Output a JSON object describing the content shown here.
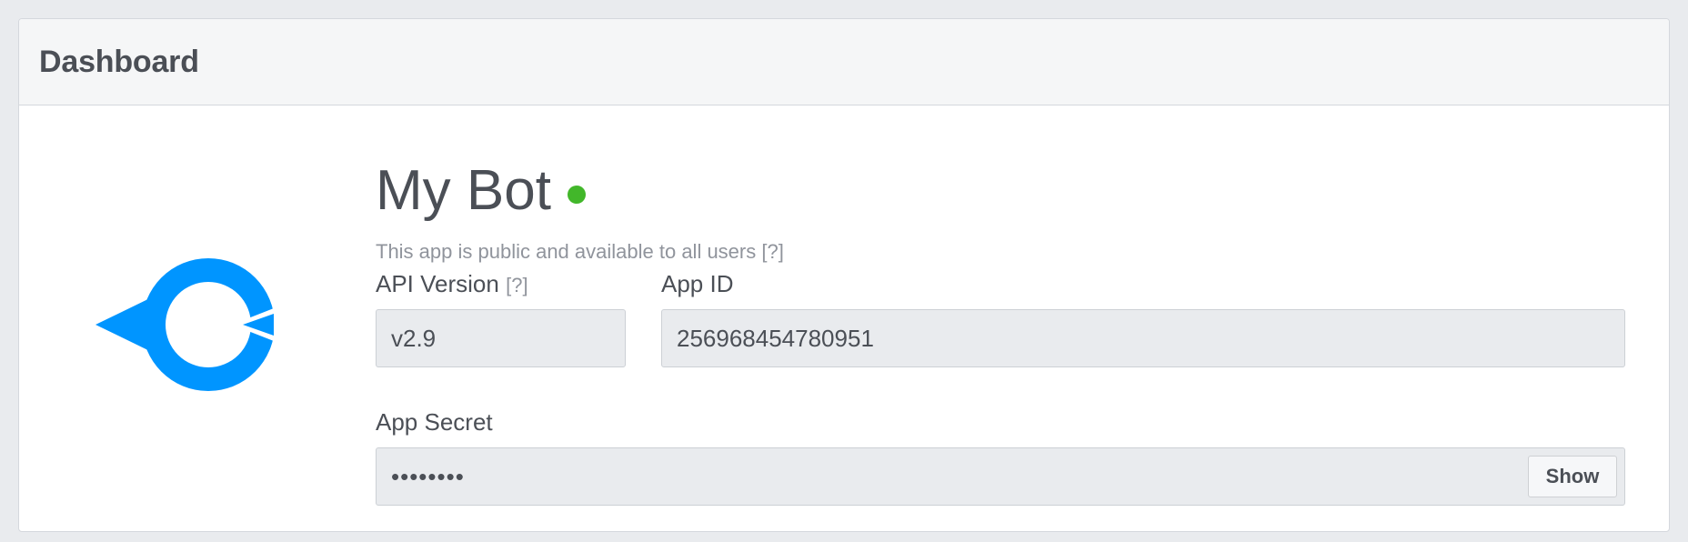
{
  "panel": {
    "title": "Dashboard"
  },
  "app": {
    "icon": "messenger-bot-icon",
    "icon_color": "#0095ff",
    "name": "My Bot",
    "status_color": "#42b72a",
    "description": "This app is public and available to all users [?]"
  },
  "fields": {
    "api_version": {
      "label": "API Version",
      "help": "[?]",
      "value": "v2.9"
    },
    "app_id": {
      "label": "App ID",
      "value": "256968454780951"
    },
    "app_secret": {
      "label": "App Secret",
      "value": "••••••••",
      "show_label": "Show"
    }
  }
}
